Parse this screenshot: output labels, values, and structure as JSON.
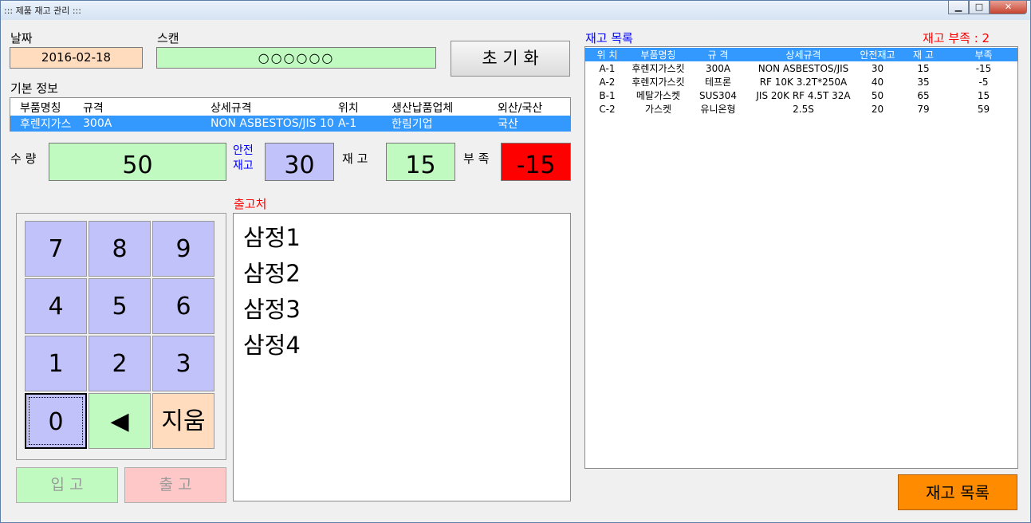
{
  "window": {
    "title": "::: 제품 재고 관리 :::",
    "minimize": "▁",
    "maximize": "□",
    "close": "✕"
  },
  "date": {
    "label": "날짜",
    "value": "2016-02-18"
  },
  "scan": {
    "label": "스캔",
    "value": "○○○○○○"
  },
  "reset_button": "초 기 화",
  "basic_info": {
    "label": "기본 정보",
    "columns": [
      "부품명칭",
      "규격",
      "상세규격",
      "위치",
      "생산납품업체",
      "외산/국산"
    ],
    "row": [
      "후렌지가스",
      "300A",
      "NON ASBESTOS/JIS 10",
      "A-1",
      "한림기업",
      "국산"
    ]
  },
  "qty": {
    "label": "수 량",
    "value": "50"
  },
  "safety": {
    "label_line1": "안전",
    "label_line2": "재고",
    "value": "30"
  },
  "stock": {
    "label": "재 고",
    "value": "15"
  },
  "shortage": {
    "label": "부 족",
    "value": "-15"
  },
  "keypad": {
    "k7": "7",
    "k8": "8",
    "k9": "9",
    "k4": "4",
    "k5": "5",
    "k6": "6",
    "k1": "1",
    "k2": "2",
    "k3": "3",
    "k0": "0",
    "back": "◀",
    "clear": "지움"
  },
  "in_button": "입 고",
  "out_button": "출 고",
  "destination": {
    "label": "출고처",
    "items": [
      "삼정1",
      "삼정2",
      "삼정3",
      "삼정4"
    ]
  },
  "inventory": {
    "title": "재고 목록",
    "shortage_count": "재고 부족 : 2",
    "columns": [
      "위 치",
      "부품명칭",
      "규 격",
      "상세규격",
      "안전재고",
      "재 고",
      "부족"
    ],
    "rows": [
      [
        "A-1",
        "후렌지가스킷",
        "300A",
        "NON ASBESTOS/JIS",
        "30",
        "15",
        "-15"
      ],
      [
        "A-2",
        "후렌지가스킷",
        "테프론",
        "RF 10K 3.2T*250A",
        "40",
        "35",
        "-5"
      ],
      [
        "B-1",
        "메탈가스켓",
        "SUS304",
        "JIS 20K RF 4.5T 32A",
        "50",
        "65",
        "15"
      ],
      [
        "C-2",
        "가스켓",
        "유니온형",
        "2.5S",
        "20",
        "79",
        "59"
      ]
    ]
  },
  "inventory_button": "재고 목록",
  "colors": {
    "accent_orange": "#ff8c00",
    "shortage_red": "#ff0000",
    "selection_blue": "#3399ff",
    "green_field": "#c0fac0",
    "lavender": "#c2c2fa",
    "peach": "#ffdcbe"
  }
}
